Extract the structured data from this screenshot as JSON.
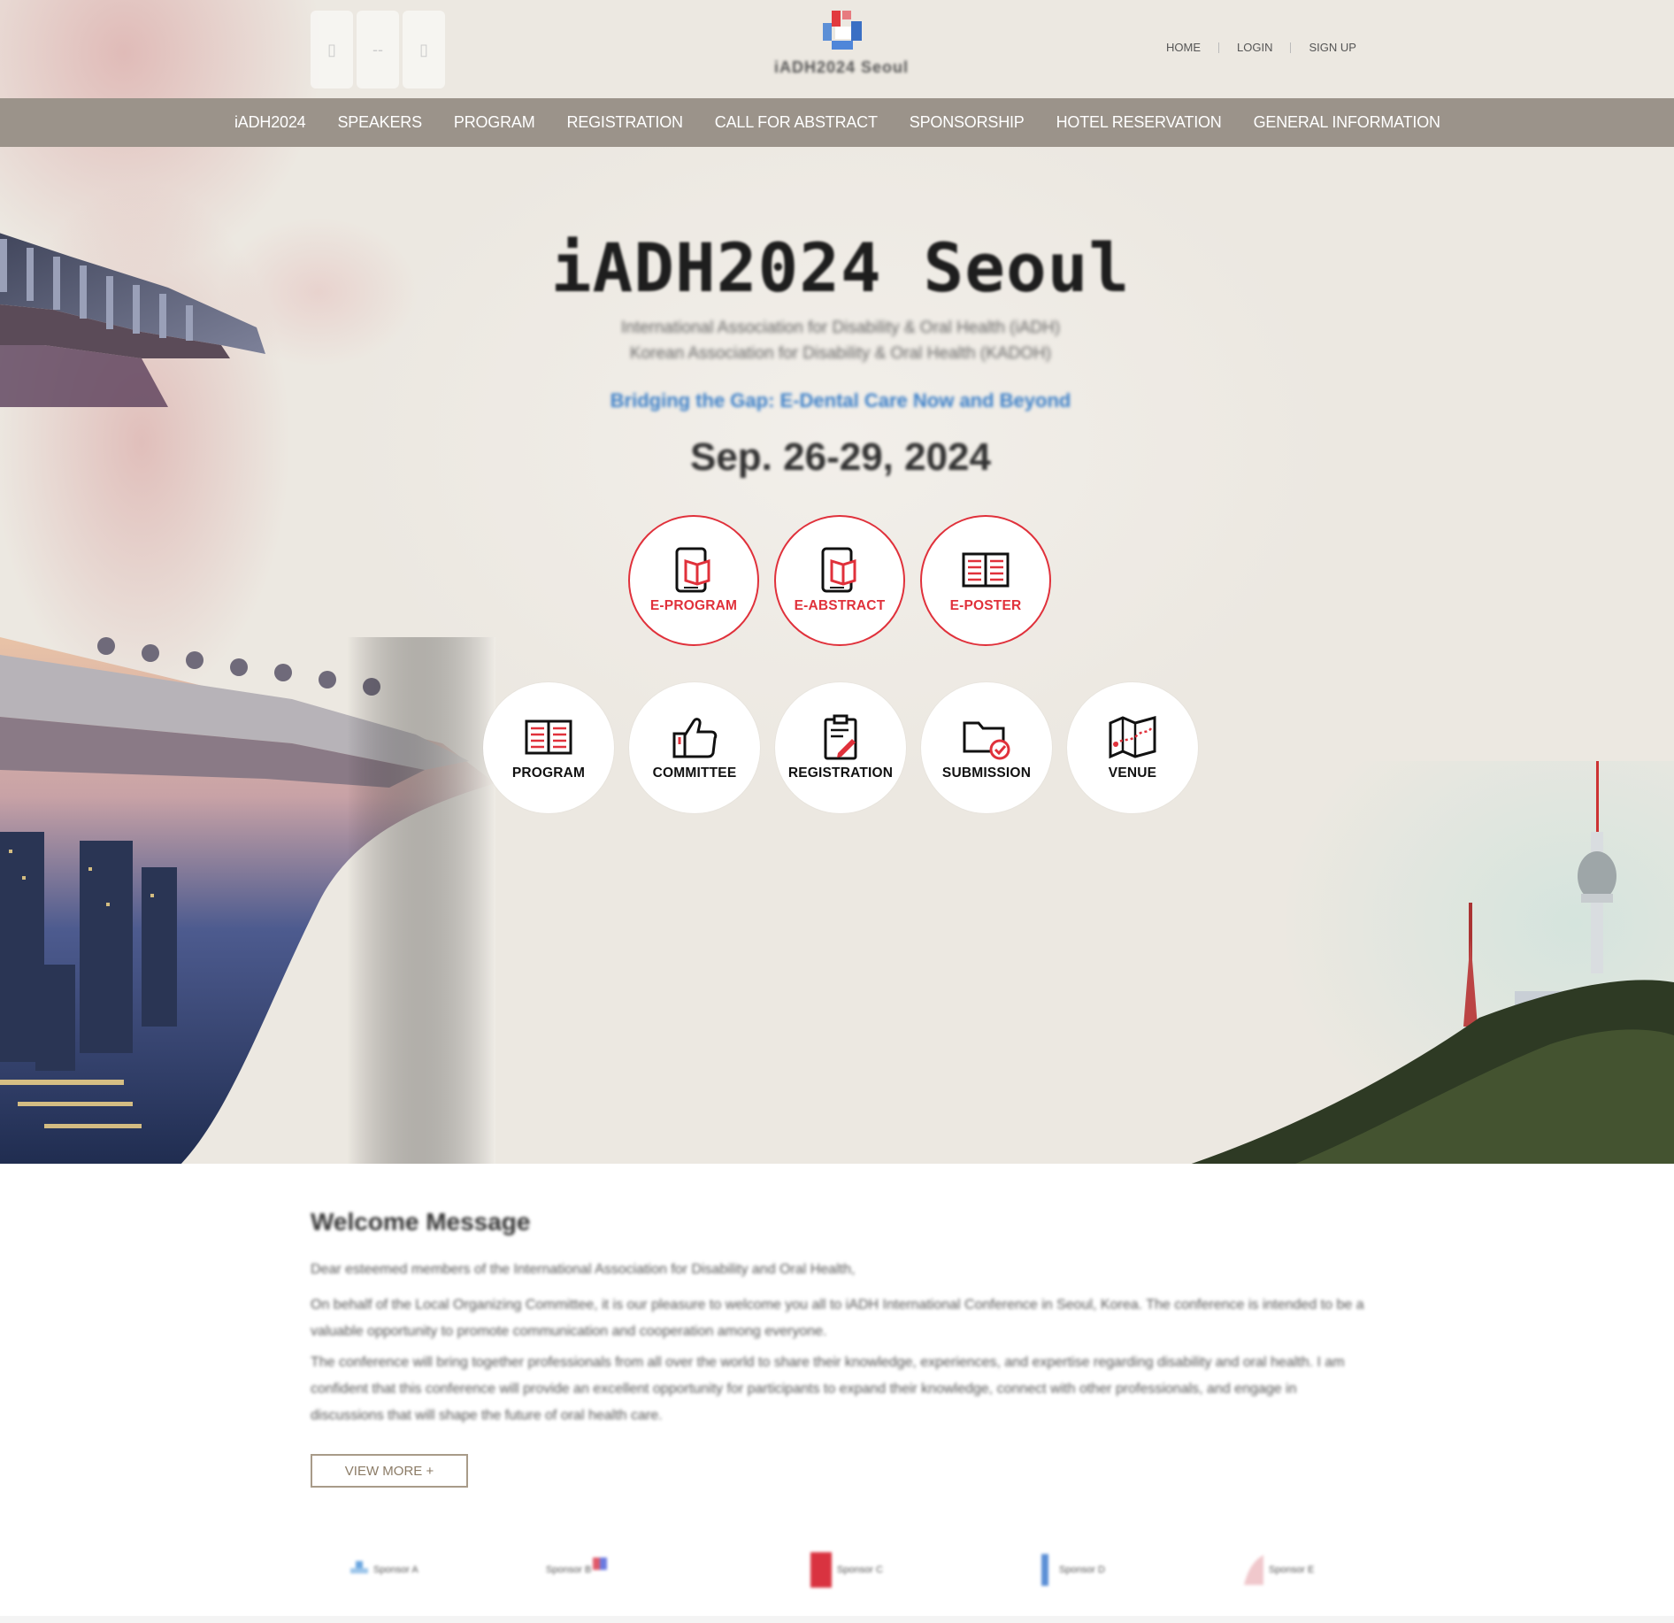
{
  "header": {
    "logo_placeholders": [
      "▯",
      "--",
      "▯"
    ],
    "site_name": "iADH2024 Seoul",
    "utility_links": [
      "HOME",
      "LOGIN",
      "SIGN UP"
    ]
  },
  "nav": [
    "iADH2024",
    "SPEAKERS",
    "PROGRAM",
    "REGISTRATION",
    "CALL FOR ABSTRACT",
    "SPONSORSHIP",
    "HOTEL RESERVATION",
    "GENERAL INFORMATION"
  ],
  "hero": {
    "title": "iADH2024 Seoul",
    "subtitle_line1": "International Association for Disability & Oral Health (iADH)",
    "subtitle_line2": "Korean Association for Disability & Oral Health (KADOH)",
    "theme": "Bridging the Gap: E-Dental Care Now and Beyond",
    "date": "Sep. 26-29, 2024"
  },
  "quick_links_top": [
    {
      "label": "E-PROGRAM",
      "icon": "phone-book-icon"
    },
    {
      "label": "E-ABSTRACT",
      "icon": "phone-book-icon"
    },
    {
      "label": "E-POSTER",
      "icon": "open-book-icon"
    }
  ],
  "quick_links_bottom": [
    {
      "label": "PROGRAM",
      "icon": "open-book-icon"
    },
    {
      "label": "COMMITTEE",
      "icon": "thumbs-up-icon"
    },
    {
      "label": "REGISTRATION",
      "icon": "clipboard-pen-icon"
    },
    {
      "label": "SUBMISSION",
      "icon": "folder-check-icon"
    },
    {
      "label": "VENUE",
      "icon": "map-icon"
    }
  ],
  "welcome": {
    "title": "Welcome Message",
    "p1": "Dear esteemed members of the International Association for Disability and Oral Health,",
    "p2": "On behalf of the Local Organizing Committee, it is our pleasure to welcome you all to iADH International Conference in Seoul, Korea. The conference is intended to be a valuable opportunity to promote communication and cooperation among everyone.",
    "p3": "The conference will bring together professionals from all over the world to share their knowledge, experiences, and expertise regarding disability and oral health. I am confident that this conference will provide an excellent opportunity for participants to expand their knowledge, connect with other professionals, and engage in discussions that will shape the future of oral health care.",
    "view_more": "VIEW MORE +"
  },
  "sponsors": [
    "Sponsor A",
    "Sponsor B",
    "Sponsor C",
    "Sponsor D",
    "Sponsor E"
  ],
  "colors": {
    "accent_red": "#e0313b",
    "nav_bg": "#9b938a",
    "theme_blue": "#3b7fc8"
  }
}
